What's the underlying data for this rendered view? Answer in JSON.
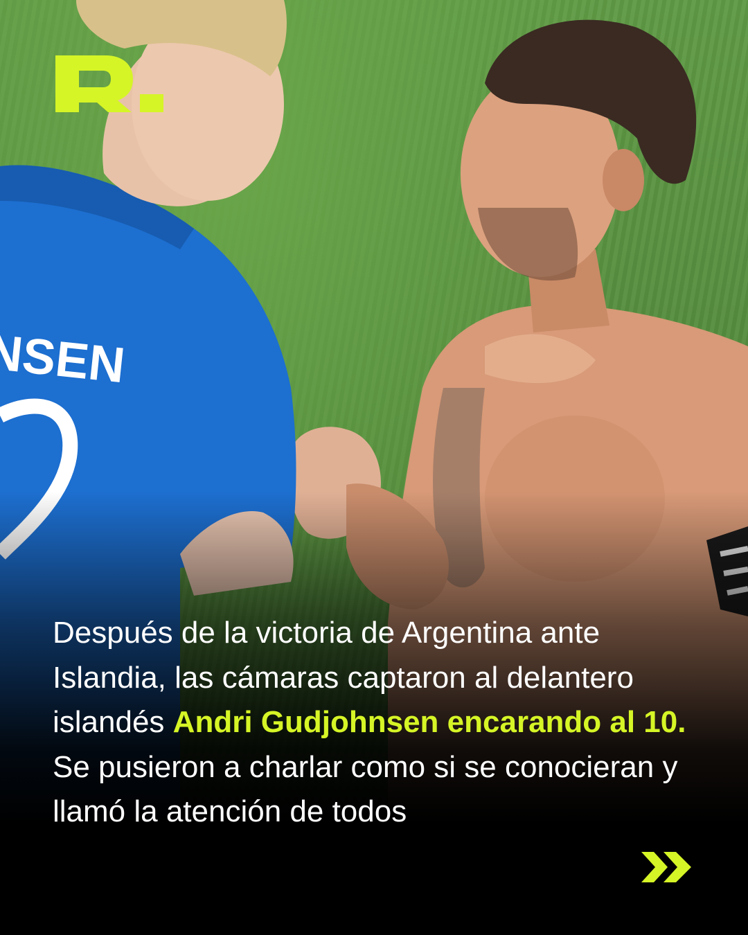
{
  "brand": {
    "logo_text": "R.",
    "accent_color": "#d6f526"
  },
  "photo": {
    "jersey_text": "NSEN"
  },
  "caption": {
    "part1": "Después de la victoria de Argentina ante Islandia, las cámaras captaron al delantero islandés ",
    "highlight": "Andri Gudjohnsen encarando al 10.",
    "part2": " Se pusieron a charlar como si se conocieran y llamó la atención de todos"
  },
  "next_button": {
    "icon": "double-chevron-right-icon"
  }
}
